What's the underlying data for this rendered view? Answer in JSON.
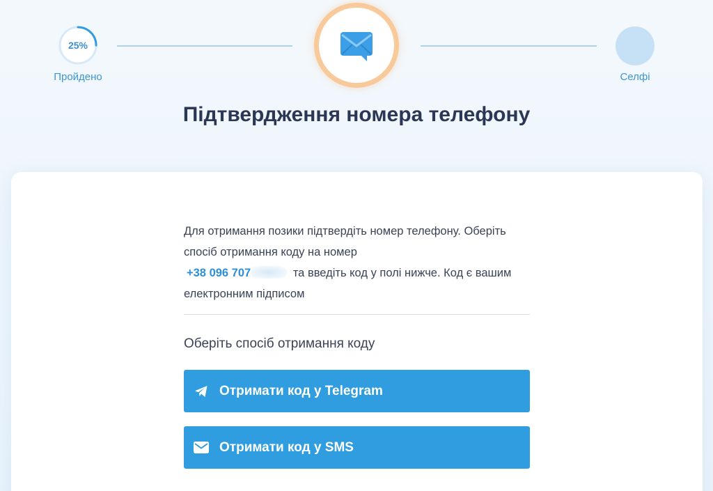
{
  "stepper": {
    "progress_text": "25%",
    "progress_fraction": 0.25,
    "completed_label": "Пройдено",
    "next_label": "Селфі",
    "current_icon": "envelope-chat-icon"
  },
  "title": "Підтвердження номера телефону",
  "info": {
    "text_before": "Для отримання позики підтвердіть номер телефону. Оберіть спосіб отримання коду на номер",
    "phone_visible": "+38 096 707",
    "text_after": "та введіть код у полі нижче. Код є вашим електронним підписом"
  },
  "choose_label": "Оберіть спосіб отримання коду",
  "buttons": {
    "telegram": {
      "label": "Отримати код у Telegram",
      "icon": "telegram-icon"
    },
    "sms": {
      "label": "Отримати код у SMS",
      "icon": "envelope-icon"
    }
  },
  "colors": {
    "accent": "#2f9de0",
    "title": "#2b3754",
    "ring": "#f6bd84",
    "link": "#2d8fd9"
  }
}
